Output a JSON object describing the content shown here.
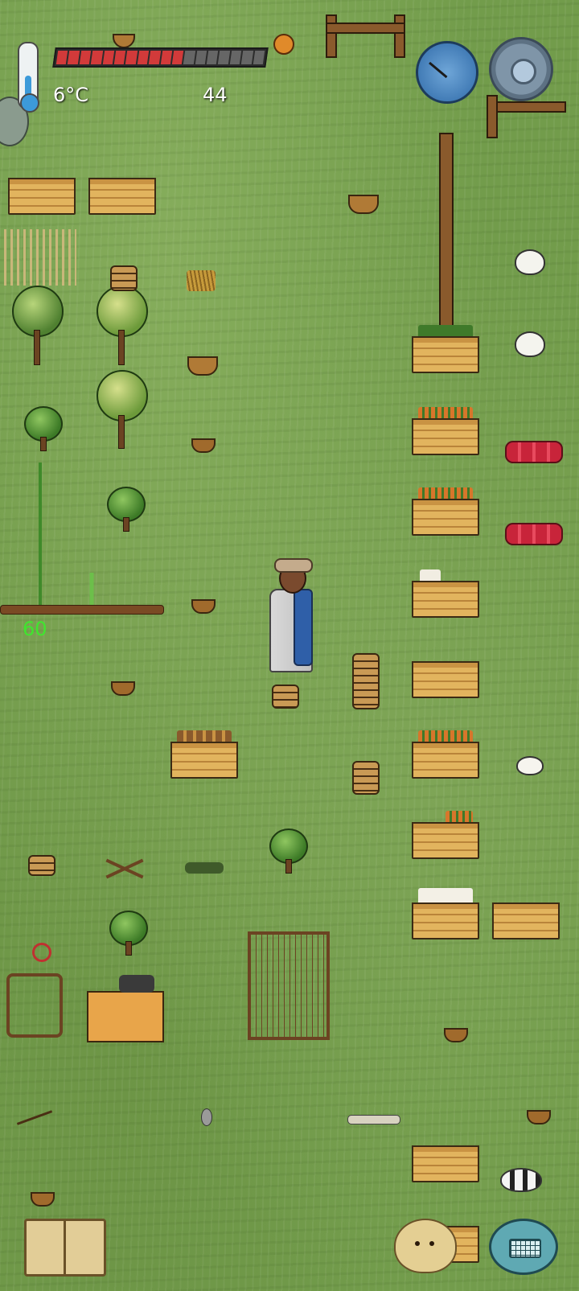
{
  "hud": {
    "temperature": "6°C",
    "yum_count": "44",
    "age_display": "60",
    "food_pips_filled": 11,
    "food_pips_total": 18
  },
  "icons": {
    "thermometer": "thermometer-icon",
    "settings": "gear-icon",
    "compass": "compass-icon",
    "tech_book": "book-icon",
    "emote": "emote-face-icon",
    "chat": "keyboard-icon"
  },
  "colors": {
    "food_bar_filled": "#d23a3a",
    "food_bar_empty": "#666666",
    "age_text": "#3fe62e",
    "temperature_fill": "#3c9ad9"
  }
}
